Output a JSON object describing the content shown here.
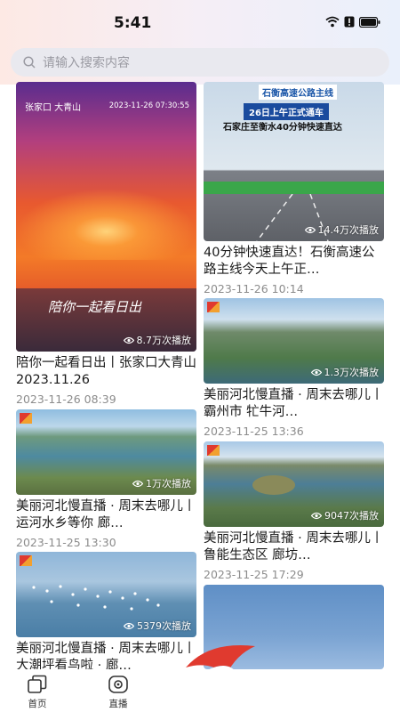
{
  "status": {
    "time": "5:41"
  },
  "search": {
    "placeholder": "请输入搜索内容"
  },
  "cards": [
    {
      "title": "陪你一起看日出丨张家口大青山 2023.11.26",
      "date": "2023-11-26 08:39",
      "plays": "8.7万次播放",
      "overlay_date": "2023-11-26 07:30:55",
      "overlay_place": "张家口 大青山",
      "overlay_text": "陪你一起看日出"
    },
    {
      "title": "40分钟快速直达！石衡高速公路主线今天上午正…",
      "date": "2023-11-26 10:14",
      "plays": "14.4万次播放",
      "banner_top": "石衡高速公路主线",
      "banner_mid": "26日上午正式通车",
      "banner_bottom": "石家庄至衡水40分钟快速直达"
    },
    {
      "title": "美丽河北慢直播 · 周末去哪儿丨霸州市 牤牛河…",
      "date": "2023-11-25 13:36",
      "plays": "1.3万次播放"
    },
    {
      "title": "美丽河北慢直播 · 周末去哪儿丨运河水乡等你 廊…",
      "date": "2023-11-25 13:30",
      "plays": "1万次播放"
    },
    {
      "title": "美丽河北慢直播 · 周末去哪儿丨鲁能生态区 廊坊…",
      "date": "2023-11-25 17:29",
      "plays": "9047次播放"
    },
    {
      "title": "美丽河北慢直播 · 周末去哪儿丨大潮坪看鸟啦 · 廊…",
      "date": "",
      "plays": "5379次播放"
    },
    {
      "title": "",
      "date": "",
      "plays": ""
    }
  ],
  "nav": {
    "home": "首页",
    "live": "直播"
  },
  "colors": {
    "accent_red": "#e03a2f",
    "accent_blue": "#1e4fa3"
  }
}
